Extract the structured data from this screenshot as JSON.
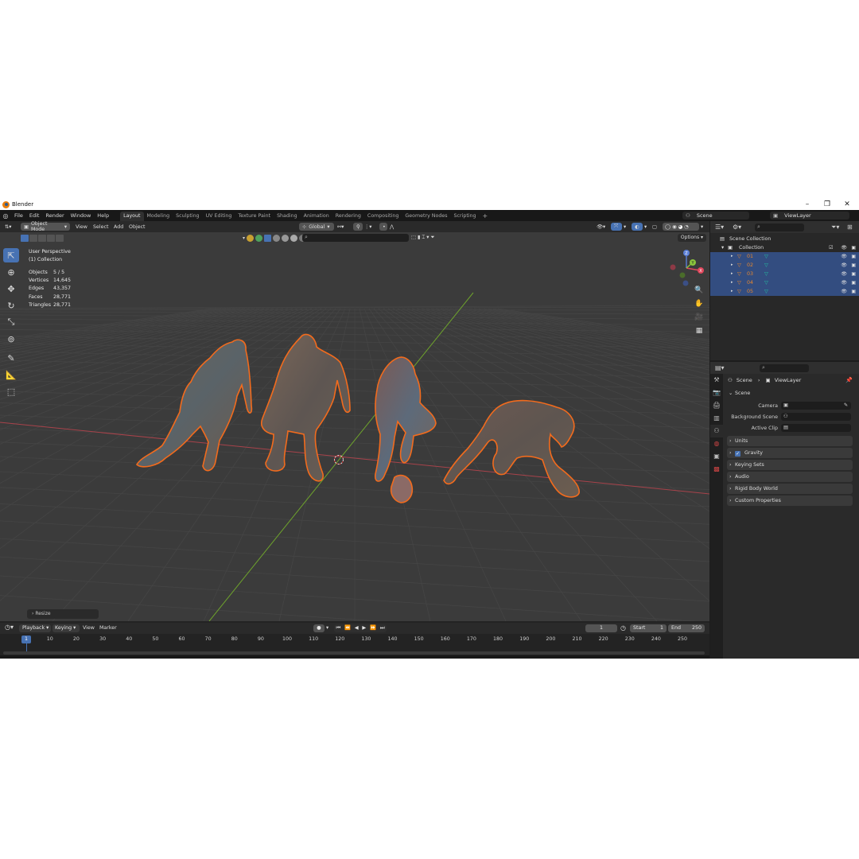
{
  "window": {
    "title": "Blender"
  },
  "menubar": {
    "menus": [
      "File",
      "Edit",
      "Render",
      "Window",
      "Help"
    ],
    "workspaces": [
      "Layout",
      "Modeling",
      "Sculpting",
      "UV Editing",
      "Texture Paint",
      "Shading",
      "Animation",
      "Rendering",
      "Compositing",
      "Geometry Nodes",
      "Scripting"
    ],
    "active_workspace": "Layout",
    "add_workspace": "+",
    "scene": "Scene",
    "view_layer": "ViewLayer"
  },
  "viewport": {
    "mode": "Object Mode",
    "menus": [
      "View",
      "Select",
      "Add",
      "Object"
    ],
    "orientation": "Global",
    "options": "Options",
    "info_line1": "User Perspective",
    "info_line2": "(1) Collection",
    "stats": [
      {
        "key": "Objects",
        "value": "5 / 5"
      },
      {
        "key": "Vertices",
        "value": "14,645"
      },
      {
        "key": "Edges",
        "value": "43,357"
      },
      {
        "key": "Faces",
        "value": "28,771"
      },
      {
        "key": "Triangles",
        "value": "28,771"
      }
    ],
    "gizmo": {
      "x": "X",
      "y": "Y",
      "z": "Z"
    },
    "last_operator": "Resize",
    "colors": {
      "background": "#3b3b3b",
      "grid": "#454545",
      "x_axis": "#a8434b",
      "y_axis": "#6ea32c",
      "selection_outline": "#f26b1d"
    }
  },
  "timeline": {
    "menus": [
      "Playback",
      "Keying",
      "View",
      "Marker"
    ],
    "current_frame": "1",
    "start_label": "Start",
    "start": "1",
    "end_label": "End",
    "end": "250",
    "ruler": [
      1,
      10,
      20,
      30,
      40,
      50,
      60,
      70,
      80,
      90,
      100,
      110,
      120,
      130,
      140,
      150,
      160,
      170,
      180,
      190,
      200,
      210,
      220,
      230,
      240,
      250
    ]
  },
  "outliner": {
    "root": "Scene Collection",
    "collection": "Collection",
    "objects": [
      "01",
      "02",
      "03",
      "04",
      "05"
    ]
  },
  "properties": {
    "breadcrumb_scene": "Scene",
    "breadcrumb_layer": "ViewLayer",
    "panel_scene": "Scene",
    "fields": [
      {
        "label": "Camera"
      },
      {
        "label": "Background Scene"
      },
      {
        "label": "Active Clip"
      }
    ],
    "panels": [
      "Units",
      "Gravity",
      "Keying Sets",
      "Audio",
      "Rigid Body World",
      "Custom Properties"
    ],
    "gravity_checked": true
  }
}
